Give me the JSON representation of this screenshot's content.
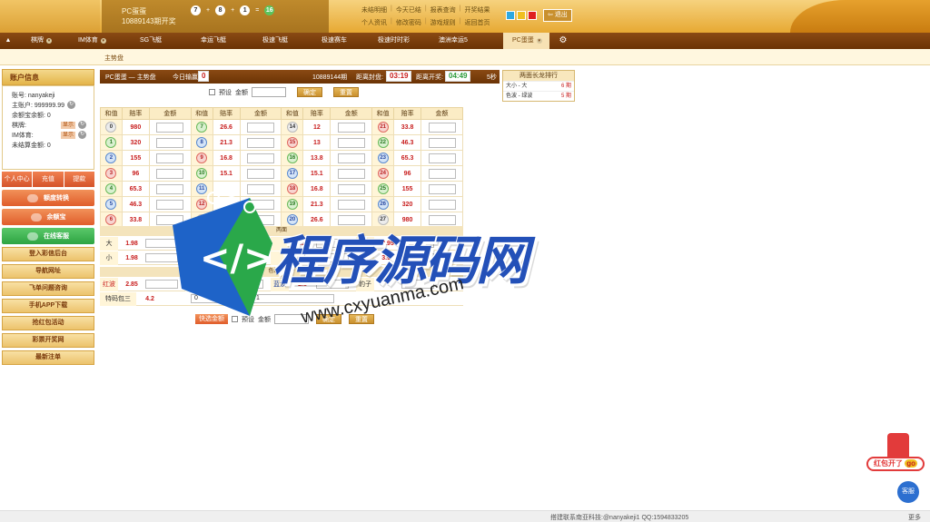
{
  "header": {
    "game_name": "PC蛋蛋",
    "issue_text": "10889143期开奖",
    "balls": [
      "7",
      "8",
      "1",
      "16"
    ],
    "links_row1": [
      "未结明细",
      "今天已结",
      "报表查询",
      "开奖结果"
    ],
    "links_row2": [
      "个人资讯",
      "修改密码",
      "游戏规则",
      "返回首页"
    ],
    "swatches": [
      "#2ea8e0",
      "#f0c020",
      "#e02020"
    ],
    "logout": "退出"
  },
  "nav": [
    "棋牌",
    "IM体育",
    "SG飞艇",
    "幸运飞艇",
    "极速飞艇",
    "极速赛车",
    "极速时时彩",
    "澳洲幸运5",
    "PC蛋蛋"
  ],
  "subnav": "主势盘",
  "account": {
    "title": "账户信息",
    "account_label": "账号: nanyakeji",
    "main_label": "主账户: 999999.99",
    "yeb_label": "余额宝余额: 0",
    "chess_label": "棋牌:",
    "im_label": "IM体育:",
    "show": "显示",
    "unsettled_label": "未结算金额: 0"
  },
  "tri_buttons": [
    "个人中心",
    "充值",
    "提款"
  ],
  "big_buttons": [
    "额度转换",
    "余额宝",
    "在线客服"
  ],
  "menu_buttons": [
    "登入彩信后台",
    "导航网址",
    "飞单问题咨询",
    "手机APP下载",
    "抢红包活动",
    "彩票开奖网",
    "最新注单"
  ],
  "gamebar": {
    "title": "PC蛋蛋 — 主势盘",
    "today_label": "今日输赢:",
    "today_value": "0",
    "issue": "10889144期",
    "close_label": "距离封盘:",
    "close_time": "03:19",
    "open_label": "距离开奖:",
    "open_time": "04:49",
    "seconds": "5秒"
  },
  "rank": {
    "title": "两面长龙排行",
    "rows": [
      {
        "name": "大小 - 大",
        "count": "6 期"
      },
      {
        "name": "色波 - 绿波",
        "count": "5 期"
      }
    ]
  },
  "form": {
    "preset": "预设",
    "amount": "金额",
    "confirm": "确定",
    "reset": "重置",
    "quick": "快选金额"
  },
  "table": {
    "headers": [
      "和值",
      "赔率",
      "金额"
    ],
    "columns": [
      [
        {
          "n": "0",
          "o": "980",
          "c": "gray"
        },
        {
          "n": "1",
          "o": "320",
          "c": "green"
        },
        {
          "n": "2",
          "o": "155",
          "c": "blue"
        },
        {
          "n": "3",
          "o": "96",
          "c": "red"
        },
        {
          "n": "4",
          "o": "65.3",
          "c": "green"
        },
        {
          "n": "5",
          "o": "46.3",
          "c": "blue"
        },
        {
          "n": "6",
          "o": "33.8",
          "c": "red"
        }
      ],
      [
        {
          "n": "7",
          "o": "26.6",
          "c": "green"
        },
        {
          "n": "8",
          "o": "21.3",
          "c": "blue"
        },
        {
          "n": "9",
          "o": "16.8",
          "c": "red"
        },
        {
          "n": "10",
          "o": "15.1",
          "c": "green"
        },
        {
          "n": "11",
          "o": "",
          "c": "blue"
        },
        {
          "n": "12",
          "o": "",
          "c": "red"
        },
        {
          "n": "13",
          "o": "",
          "c": "gray"
        }
      ],
      [
        {
          "n": "14",
          "o": "12",
          "c": "gray"
        },
        {
          "n": "15",
          "o": "13",
          "c": "red"
        },
        {
          "n": "16",
          "o": "13.8",
          "c": "green"
        },
        {
          "n": "17",
          "o": "15.1",
          "c": "blue"
        },
        {
          "n": "18",
          "o": "16.8",
          "c": "red"
        },
        {
          "n": "19",
          "o": "21.3",
          "c": "green"
        },
        {
          "n": "20",
          "o": "26.6",
          "c": "blue"
        }
      ],
      [
        {
          "n": "21",
          "o": "33.8",
          "c": "red"
        },
        {
          "n": "22",
          "o": "46.3",
          "c": "green"
        },
        {
          "n": "23",
          "o": "65.3",
          "c": "blue"
        },
        {
          "n": "24",
          "o": "96",
          "c": "red"
        },
        {
          "n": "25",
          "o": "155",
          "c": "green"
        },
        {
          "n": "26",
          "o": "320",
          "c": "blue"
        },
        {
          "n": "27",
          "o": "980",
          "c": "gray"
        }
      ]
    ]
  },
  "section2": {
    "title": "两面",
    "row1": [
      {
        "l": "大",
        "o": "1.98"
      },
      {
        "l": "",
        "o": "1."
      },
      {
        "l": "",
        "o": "3.95"
      },
      {
        "l": "大双",
        "o": "3.95"
      }
    ],
    "row2": [
      {
        "l": "小",
        "o": "1.98"
      },
      {
        "l": "小",
        "o": ""
      },
      {
        "l": "",
        "o": ""
      },
      {
        "l": "小双",
        "o": "3.95"
      }
    ],
    "color_title": "色波 / 豹子",
    "color_row": [
      {
        "l": "红波",
        "o": "2.85"
      },
      {
        "l": "",
        "o": "2.85"
      },
      {
        "l": "蓝波",
        "o": "2.8"
      },
      {
        "l": "豹子",
        "o": ""
      }
    ],
    "special_label": "特码包三",
    "special_odds": "4.2",
    "select_a": "0",
    "select_b": "1"
  },
  "watermark": {
    "text": "程序源码网",
    "url": "www.cxyuanma.com"
  },
  "redpack": {
    "label": "红包开了",
    "badge": "go"
  },
  "chat": "客服",
  "footer": {
    "text": "搭建联系南亚科技:@nanyakeji1 QQ:1594833205",
    "more": "更多"
  }
}
